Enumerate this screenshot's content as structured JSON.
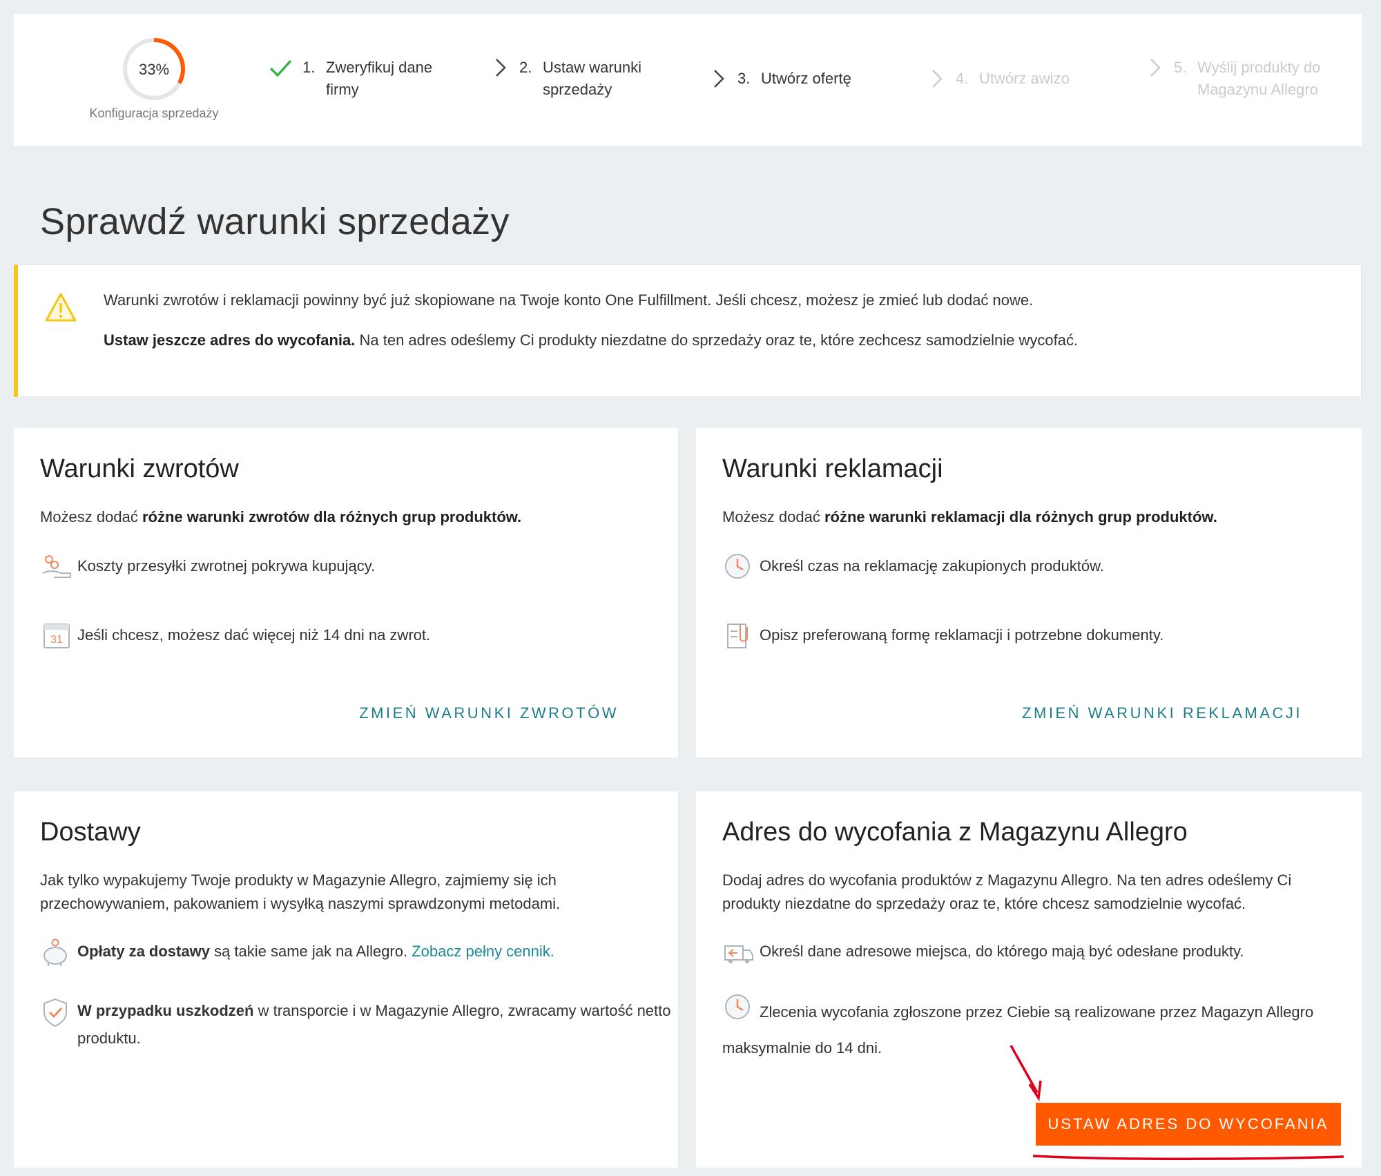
{
  "stepper": {
    "progress_percent": "33%",
    "progress_value": 0.33,
    "progress_caption": "Konfiguracja sprzedaży",
    "steps": [
      {
        "num": "1.",
        "label": "Zweryfikuj dane firmy",
        "state": "done"
      },
      {
        "num": "2.",
        "label": "Ustaw warunki sprzedaży",
        "state": "active"
      },
      {
        "num": "3.",
        "label": "Utwórz ofertę",
        "state": "active"
      },
      {
        "num": "4.",
        "label": "Utwórz awizo",
        "state": "future"
      },
      {
        "num": "5.",
        "label": "Wyślij produkty do Magazynu Allegro",
        "state": "future"
      }
    ]
  },
  "page_title": "Sprawdź warunki sprzedaży",
  "notice": {
    "line1": "Warunki zwrotów i reklamacji powinny być już skopiowane na Twoje konto One Fulfillment. Jeśli chcesz, możesz je zmieć lub dodać nowe.",
    "line2_bold": "Ustaw jeszcze adres do wycofania.",
    "line2_rest": " Na ten adres odeślemy Ci produkty niezdatne do sprzedaży oraz te, które zechcesz samodzielnie wycofać."
  },
  "returns": {
    "title": "Warunki zwrotów",
    "desc_pre": "Możesz dodać ",
    "desc_bold": "różne warunki zwrotów dla różnych grup produktów.",
    "item1": "Koszty przesyłki zwrotnej pokrywa kupujący.",
    "item2": "Jeśli chcesz, możesz dać więcej niż 14 dni na zwrot.",
    "calendar_day": "31",
    "action": "ZMIEŃ WARUNKI ZWROTÓW"
  },
  "complaints": {
    "title": "Warunki reklamacji",
    "desc_pre": "Możesz dodać ",
    "desc_bold": "różne warunki reklamacji dla różnych grup produktów.",
    "item1": "Określ czas na reklamację zakupionych produktów.",
    "item2": "Opisz preferowaną formę reklamacji i potrzebne dokumenty.",
    "action": "ZMIEŃ WARUNKI REKLAMACJI"
  },
  "delivery": {
    "title": "Dostawy",
    "desc": "Jak tylko wypakujemy Twoje produkty w Magazynie Allegro, zajmiemy się ich przechowywaniem, pakowaniem i wysyłką naszymi sprawdzonymi metodami.",
    "item1_bold": "Opłaty za dostawy",
    "item1_rest": " są takie same jak na Allegro. ",
    "item1_link": "Zobacz pełny cennik.",
    "item2_bold": "W przypadku uszkodzeń",
    "item2_rest": " w transporcie i w Magazynie Allegro, zwracamy wartość netto produktu."
  },
  "withdraw": {
    "title": "Adres do wycofania z Magazynu Allegro",
    "desc": "Dodaj adres do wycofania produktów z Magazynu Allegro. Na ten adres odeślemy Ci produkty niezdatne do sprzedaży oraz te, które chcesz samodzielnie wycofać.",
    "item1": "Określ dane adresowe miejsca, do którego mają być odesłane produkty.",
    "item2_a": "Zlecenia wycofania zgłoszone przez Ciebie są realizowane przez Magazyn Allegro",
    "item2_b": "maksymalnie  do 14 dni.",
    "button": "USTAW ADRES DO WYCOFANIA"
  },
  "colors": {
    "accent_orange": "#ff5a00",
    "link_teal": "#1e7c88",
    "notice_yellow": "#f5c518",
    "check_green": "#3cb34a",
    "annotation_red": "#e0001b"
  }
}
